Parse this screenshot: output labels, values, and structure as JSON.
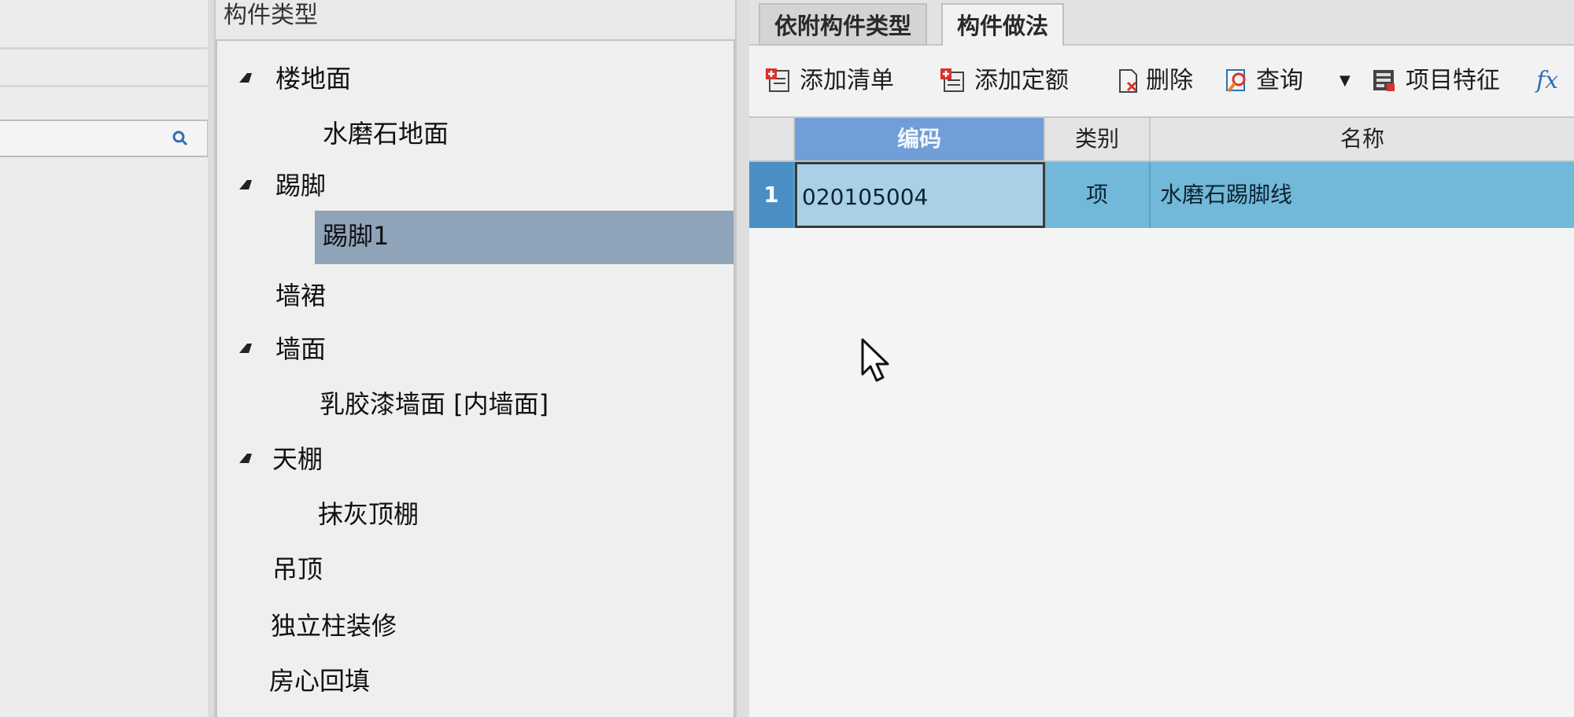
{
  "left_panel": {
    "title": "构件类型",
    "tree": [
      {
        "label": "楼地面",
        "expanded": true,
        "level": 0
      },
      {
        "label": "水磨石地面",
        "level": 1
      },
      {
        "label": "踢脚",
        "expanded": true,
        "level": 0
      },
      {
        "label": "踢脚1",
        "level": 1,
        "selected": true
      },
      {
        "label": "墙裙",
        "level": 0
      },
      {
        "label": "墙面",
        "expanded": true,
        "level": 0
      },
      {
        "label": "乳胶漆墙面 [内墙面]",
        "level": 1
      },
      {
        "label": "天棚",
        "expanded": true,
        "level": 0
      },
      {
        "label": "抹灰顶棚",
        "level": 1
      },
      {
        "label": "吊顶",
        "level": 0
      },
      {
        "label": "独立柱装修",
        "level": 0
      },
      {
        "label": "房心回填",
        "level": 0
      }
    ]
  },
  "tabs": [
    {
      "label": "依附构件类型",
      "active": false
    },
    {
      "label": "构件做法",
      "active": true
    }
  ],
  "toolbar": {
    "add_list": "添加清单",
    "add_quota": "添加定额",
    "delete": "删除",
    "query": "查询",
    "item_feature": "项目特征",
    "fx": "fx"
  },
  "grid": {
    "columns": [
      "编码",
      "类别",
      "名称"
    ],
    "rows": [
      {
        "num": "1",
        "code": "020105004",
        "category": "项",
        "name": "水磨石踢脚线"
      }
    ]
  },
  "colors": {
    "selection": "#8fa3b9",
    "row_highlight": "#72b8d8",
    "header_active": "#6f9fd6"
  }
}
